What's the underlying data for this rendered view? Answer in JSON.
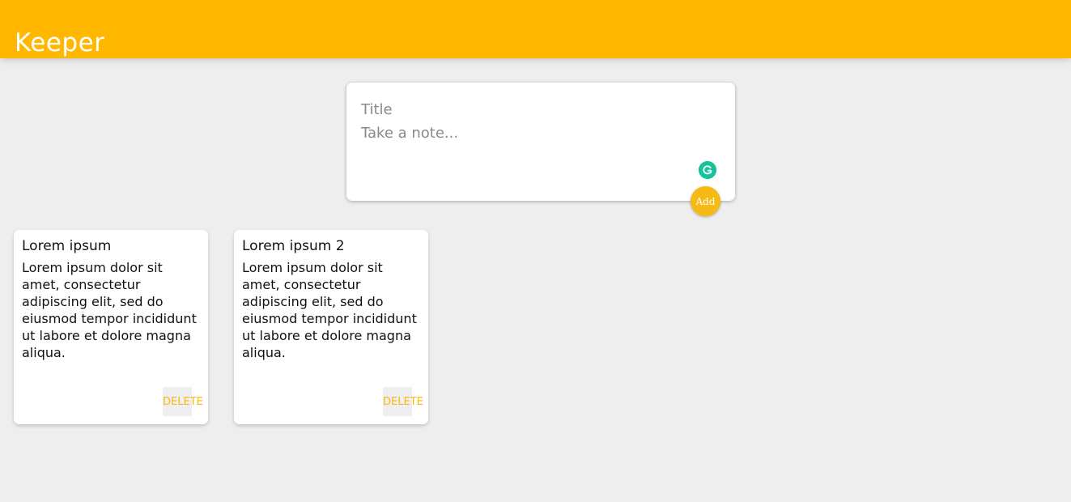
{
  "header": {
    "title": "Keeper"
  },
  "create_note": {
    "title_placeholder": "Title",
    "content_placeholder": "Take a note...",
    "add_label": "Add"
  },
  "notes": [
    {
      "title": "Lorem ipsum",
      "content": "Lorem ipsum dolor sit amet, consectetur adipiscing elit, sed do eiusmod tempor incididunt ut labore et dolore magna aliqua.",
      "delete_label": "DELETE"
    },
    {
      "title": "Lorem ipsum 2",
      "content": "Lorem ipsum dolor sit amet, consectetur adipiscing elit, sed do eiusmod tempor incididunt ut labore et dolore magna aliqua.",
      "delete_label": "DELETE"
    }
  ],
  "colors": {
    "header_bg": "#ffb700",
    "accent": "#f5ba13",
    "page_bg": "#eeeeee",
    "grammarly": "#15c39a"
  },
  "icons": {
    "grammarly": "grammarly-icon"
  }
}
